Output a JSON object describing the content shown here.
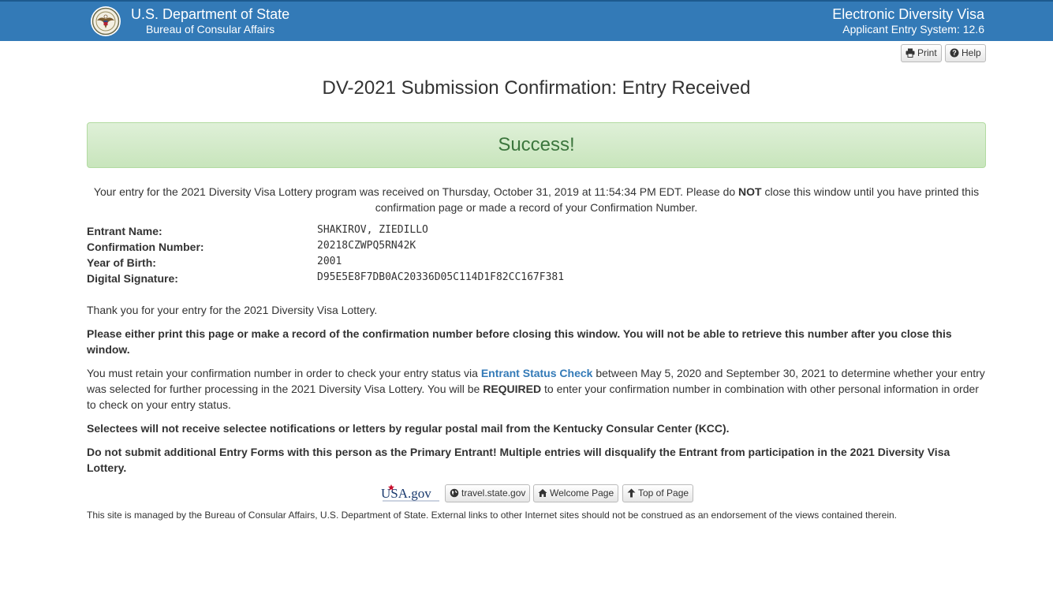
{
  "header": {
    "dept": "U.S. Department of State",
    "bureau": "Bureau of Consular Affairs",
    "system_name": "Electronic Diversity Visa",
    "system_version": "Applicant Entry System: 12.6"
  },
  "toolbar": {
    "print_label": "Print",
    "help_label": "Help"
  },
  "page_title": "DV-2021 Submission Confirmation: Entry Received",
  "alert": "Success!",
  "received": {
    "pre": "Your entry for the 2021 Diversity Visa Lottery program was received on Thursday, October 31, 2019 at 11:54:34 PM EDT. Please do ",
    "emph": "NOT",
    "post": " close this window until you have printed this confirmation page or made a record of your Confirmation Number."
  },
  "entry": {
    "name_label": "Entrant Name:",
    "name": "SHAKIROV, ZIEDILLO",
    "confirmation_label": "Confirmation Number:",
    "confirmation": "20218CZWPQ5RN42K",
    "birth_label": "Year of Birth:",
    "birth": "2001",
    "signature_label": "Digital Signature:",
    "signature": "D95E5E8F7DB0AC20336D05C114D1F82CC167F381"
  },
  "body": {
    "thanks": "Thank you for your entry for the 2021 Diversity Visa Lottery.",
    "print_notice": "Please either print this page or make a record of the confirmation number before closing this window. You will not be able to retrieve this number after you close this window.",
    "retain_pre": "You must retain your confirmation number in order to check your entry status via ",
    "retain_link": "Entrant Status Check",
    "retain_mid": " between May 5, 2020 and September 30, 2021 to determine whether your entry was selected for further processing in the 2021 Diversity Visa Lottery. You will be ",
    "retain_emph": "REQUIRED",
    "retain_post": " to enter your confirmation number in combination with other personal information in order to check on your entry status.",
    "selectees": "Selectees will not receive selectee notifications or letters by regular postal mail from the Kentucky Consular Center (KCC).",
    "duplicate": "Do not submit additional Entry Forms with this person as the Primary Entrant! Multiple entries will disqualify the Entrant from participation in the 2021 Diversity Visa Lottery."
  },
  "links": {
    "usagov_logo": "USA.gov",
    "travel": "travel.state.gov",
    "welcome": "Welcome Page",
    "top": "Top of Page"
  },
  "footer": "This site is managed by the Bureau of Consular Affairs, U.S. Department of State. External links to other Internet sites should not be construed as an endorsement of the views contained therein.",
  "colors": {
    "header_bg": "#337ab7",
    "success_text": "#3c763d",
    "success_bg": "#dff0d8",
    "link": "#337ab7"
  },
  "icons": [
    "seal-icon",
    "printer-icon",
    "question-circle-icon",
    "globe-icon",
    "home-icon",
    "arrow-up-icon"
  ]
}
